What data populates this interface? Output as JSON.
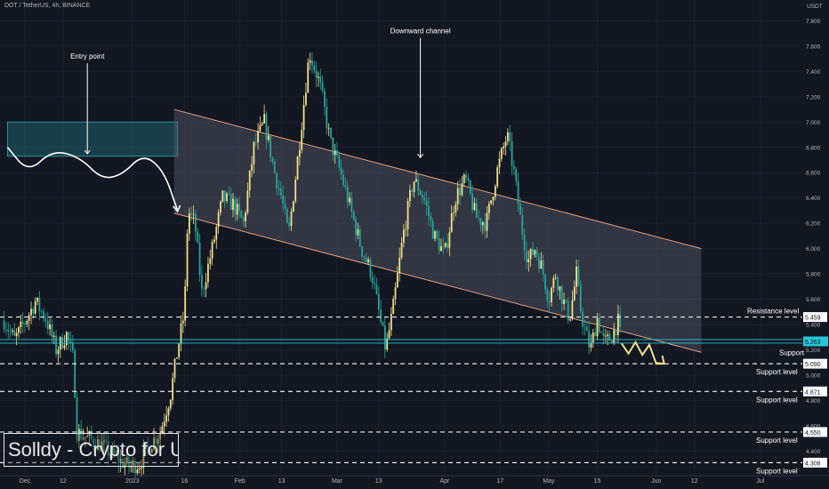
{
  "header": {
    "symbol_title": "DOT / TetherUS, 4h, BINANCE",
    "currency": "USDT"
  },
  "brand": {
    "text": "Solldy - Crypto for U"
  },
  "colors": {
    "background": "#131722",
    "candle_up": "#f1e08a",
    "candle_down": "#26a69a",
    "channel_fill": "#5d6070",
    "channel_border": "#e5a07b",
    "entry_zone": "#2a8f9b",
    "dashed_levels": "#e6e6e6",
    "price_badge": "#26c6da"
  },
  "chart_data": {
    "type": "candlestick",
    "title": "DOT / TetherUS, 4h, BINANCE",
    "ylabel": "USDT",
    "ylim": [
      4.2,
      7.9
    ],
    "y_ticks": [
      4.2,
      4.4,
      4.6,
      4.8,
      5.0,
      5.2,
      5.4,
      5.6,
      5.8,
      6.0,
      6.2,
      6.4,
      6.6,
      6.8,
      7.0,
      7.2,
      7.4,
      7.6,
      7.8
    ],
    "x_tick_labels": [
      {
        "label": "Dec",
        "day": 0
      },
      {
        "label": "12",
        "day": 11
      },
      {
        "label": "2023",
        "day": 31
      },
      {
        "label": "16",
        "day": 46
      },
      {
        "label": "Feb",
        "day": 62
      },
      {
        "label": "13",
        "day": 74
      },
      {
        "label": "Mar",
        "day": 90
      },
      {
        "label": "13",
        "day": 102
      },
      {
        "label": "Apr",
        "day": 121
      },
      {
        "label": "17",
        "day": 137
      },
      {
        "label": "May",
        "day": 151
      },
      {
        "label": "15",
        "day": 165
      },
      {
        "label": "Jun",
        "day": 182
      },
      {
        "label": "12",
        "day": 193
      },
      {
        "label": "Jul",
        "day": 212
      }
    ],
    "price_path": [
      [
        -6,
        5.43
      ],
      [
        -3,
        5.28
      ],
      [
        0,
        5.42
      ],
      [
        3,
        5.58
      ],
      [
        6,
        5.45
      ],
      [
        9,
        5.2
      ],
      [
        12,
        5.32
      ],
      [
        14,
        5.12
      ],
      [
        15,
        4.55
      ],
      [
        18,
        4.5
      ],
      [
        22,
        4.45
      ],
      [
        26,
        4.35
      ],
      [
        30,
        4.28
      ],
      [
        33,
        4.3
      ],
      [
        36,
        4.45
      ],
      [
        39,
        4.55
      ],
      [
        42,
        4.85
      ],
      [
        44,
        5.2
      ],
      [
        46,
        5.5
      ],
      [
        47,
        6.3
      ],
      [
        49,
        6.2
      ],
      [
        51,
        5.65
      ],
      [
        54,
        6.0
      ],
      [
        57,
        6.4
      ],
      [
        60,
        6.35
      ],
      [
        63,
        6.2
      ],
      [
        66,
        6.8
      ],
      [
        69,
        7.0
      ],
      [
        72,
        6.6
      ],
      [
        74,
        6.4
      ],
      [
        76,
        6.1
      ],
      [
        79,
        6.8
      ],
      [
        82,
        7.55
      ],
      [
        85,
        7.3
      ],
      [
        88,
        6.85
      ],
      [
        91,
        6.6
      ],
      [
        94,
        6.3
      ],
      [
        97,
        6.0
      ],
      [
        100,
        5.8
      ],
      [
        102,
        5.5
      ],
      [
        104,
        5.2
      ],
      [
        106,
        5.5
      ],
      [
        109,
        6.1
      ],
      [
        112,
        6.55
      ],
      [
        115,
        6.4
      ],
      [
        118,
        6.1
      ],
      [
        121,
        5.95
      ],
      [
        124,
        6.4
      ],
      [
        127,
        6.55
      ],
      [
        130,
        6.25
      ],
      [
        133,
        6.2
      ],
      [
        136,
        6.6
      ],
      [
        139,
        6.9
      ],
      [
        141,
        6.6
      ],
      [
        143,
        6.2
      ],
      [
        145,
        5.9
      ],
      [
        147,
        6.0
      ],
      [
        149,
        5.85
      ],
      [
        151,
        5.6
      ],
      [
        153,
        5.8
      ],
      [
        155,
        5.6
      ],
      [
        157,
        5.45
      ],
      [
        159,
        5.8
      ],
      [
        160,
        5.55
      ],
      [
        161,
        5.4
      ],
      [
        163,
        5.2
      ],
      [
        165,
        5.45
      ],
      [
        167,
        5.25
      ],
      [
        169,
        5.3
      ],
      [
        171,
        5.42
      ],
      [
        172,
        5.25
      ]
    ],
    "channel": {
      "upper": [
        [
          43,
          7.1
        ],
        [
          195,
          6.0
        ]
      ],
      "lower": [
        [
          43,
          6.28
        ],
        [
          195,
          5.18
        ]
      ]
    },
    "entry_zone": {
      "x_range": [
        -5,
        44
      ],
      "y_range": [
        6.73,
        7.0
      ]
    },
    "entry_path": [
      [
        -5,
        6.8
      ],
      [
        1,
        6.6
      ],
      [
        8,
        6.78
      ],
      [
        16,
        6.72
      ],
      [
        22,
        6.55
      ],
      [
        28,
        6.58
      ],
      [
        34,
        6.75
      ],
      [
        40,
        6.62
      ],
      [
        44,
        6.3
      ]
    ],
    "forecast_path": [
      [
        172,
        5.25
      ],
      [
        174,
        5.17
      ],
      [
        176,
        5.26
      ],
      [
        178,
        5.16
      ],
      [
        180,
        5.24
      ],
      [
        182,
        5.09
      ],
      [
        184,
        5.09
      ]
    ],
    "levels": [
      {
        "price": 5.459,
        "label": "Resistance level",
        "price_label": "5.459"
      },
      {
        "price": 5.263,
        "label": "Support",
        "price_label": "5.263",
        "current": true
      },
      {
        "price": 5.09,
        "label": "Support level",
        "price_label": "5.090"
      },
      {
        "price": 4.871,
        "label": "Support level",
        "price_label": "4.871"
      },
      {
        "price": 4.55,
        "label": "Support level",
        "price_label": "4.550"
      },
      {
        "price": 4.308,
        "label": "Support level",
        "price_label": "4.308"
      }
    ],
    "annotations": [
      {
        "text": "Entry point",
        "x": 18,
        "y": 7.5,
        "arrow_to": [
          18,
          6.75
        ]
      },
      {
        "text": "Downward channel",
        "x": 114,
        "y": 7.7,
        "arrow_to": [
          114,
          6.72
        ]
      }
    ]
  }
}
